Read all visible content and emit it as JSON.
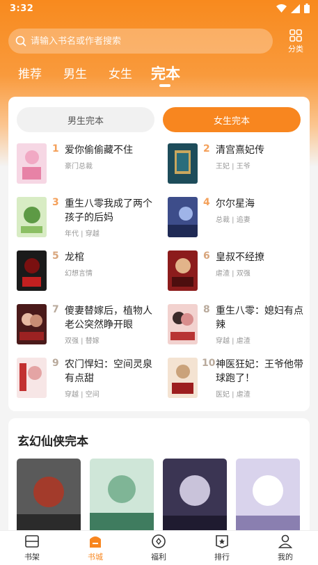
{
  "status": {
    "time": "3:32"
  },
  "search": {
    "placeholder": "请输入书名或作者搜索"
  },
  "category": {
    "label": "分类"
  },
  "tabs": [
    {
      "label": "推荐"
    },
    {
      "label": "男生"
    },
    {
      "label": "女生"
    },
    {
      "label": "完本"
    }
  ],
  "segments": {
    "male": "男生完本",
    "female": "女生完本"
  },
  "books": [
    {
      "rank": "1",
      "title": "爱你偷偷藏不住",
      "tags": "豪门总裁"
    },
    {
      "rank": "2",
      "title": "清宫熹妃传",
      "tags": "王妃 | 王爷"
    },
    {
      "rank": "3",
      "title": "重生八零我成了两个孩子的后妈",
      "tags": "年代 | 穿越"
    },
    {
      "rank": "4",
      "title": "尔尔星海",
      "tags": "总裁 | 追妻"
    },
    {
      "rank": "5",
      "title": "龙棺",
      "tags": "幻想言情"
    },
    {
      "rank": "6",
      "title": "皇叔不经撩",
      "tags": "虐渣 | 双强"
    },
    {
      "rank": "7",
      "title": "傻妻替嫁后，植物人老公突然睁开眼",
      "tags": "双强 | 替嫁"
    },
    {
      "rank": "8",
      "title": "重生八零：媳妇有点辣",
      "tags": "穿越 | 虐渣"
    },
    {
      "rank": "9",
      "title": "农门悍妇：空间灵泉有点甜",
      "tags": "穿越 | 空间"
    },
    {
      "rank": "10",
      "title": "神医狂妃：王爷他带球跑了！",
      "tags": "医妃 | 虐渣"
    }
  ],
  "section2": {
    "title": "玄幻仙侠完本"
  },
  "nav": [
    {
      "label": "书架",
      "icon": "bookshelf-icon"
    },
    {
      "label": "书城",
      "icon": "bookstore-icon"
    },
    {
      "label": "福利",
      "icon": "welfare-icon"
    },
    {
      "label": "排行",
      "icon": "ranking-icon"
    },
    {
      "label": "我的",
      "icon": "profile-icon"
    }
  ],
  "colors": {
    "accent": "#f8861f",
    "rank_top": "#f4a05a"
  }
}
